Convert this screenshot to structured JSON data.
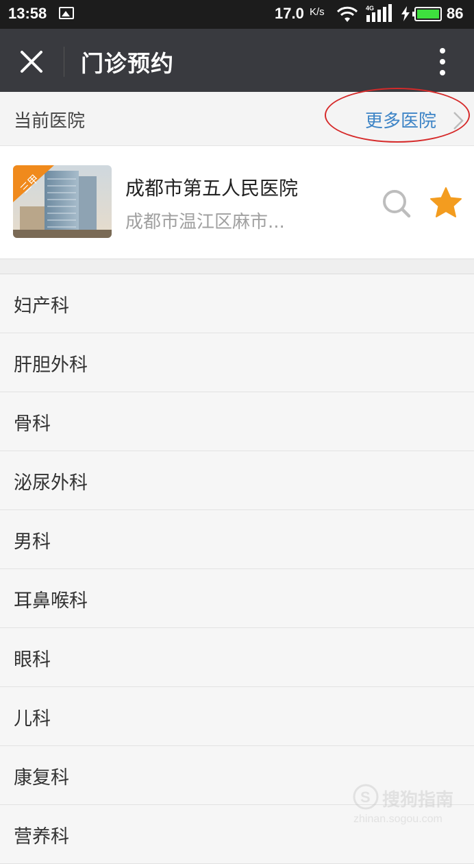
{
  "status_bar": {
    "time": "13:58",
    "net_speed": "17.0",
    "net_speed_unit": "K/s",
    "signal_type": "4G",
    "battery": "86"
  },
  "app_bar": {
    "title": "门诊预约",
    "close_icon": "close-icon",
    "more_icon": "more-vertical-icon"
  },
  "current_hospital": {
    "label": "当前医院",
    "more_link": "更多医院"
  },
  "hospital": {
    "badge": "三甲",
    "name": "成都市第五人民医院",
    "address": "成都市温江区麻市..."
  },
  "departments": [
    "妇产科",
    "肝胆外科",
    "骨科",
    "泌尿外科",
    "男科",
    "耳鼻喉科",
    "眼科",
    "儿科",
    "康复科",
    "营养科"
  ],
  "watermark": {
    "text": "搜狗指南",
    "domain": "zhinan.sogou.com"
  },
  "colors": {
    "app_bar": "#393a3f",
    "status_bar": "#1c1c1c",
    "link": "#3d84c6",
    "star": "#f39c1f",
    "annotation": "#d62a2a",
    "battery": "#3ee03e"
  }
}
